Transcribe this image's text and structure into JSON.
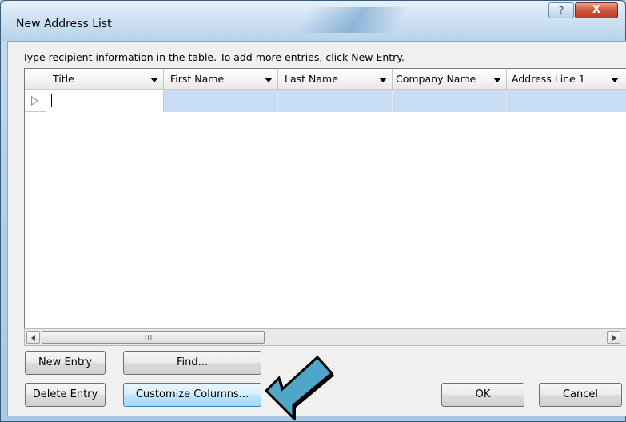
{
  "window": {
    "title": "New Address List",
    "help_glyph": "?",
    "close_glyph": "X"
  },
  "instructions": "Type recipient information in the table.  To add more entries, click New Entry.",
  "table": {
    "columns": [
      {
        "label": "Title"
      },
      {
        "label": "First Name"
      },
      {
        "label": "Last Name"
      },
      {
        "label": "Company Name"
      },
      {
        "label": "Address Line 1"
      }
    ],
    "rows": [
      {
        "cells": [
          "",
          "",
          "",
          "",
          ""
        ]
      }
    ]
  },
  "scrollbar": {
    "grip": "III"
  },
  "buttons": {
    "new_entry": "New Entry",
    "find": "Find...",
    "delete_entry": "Delete Entry",
    "customize_columns": "Customize Columns...",
    "ok": "OK",
    "cancel": "Cancel"
  },
  "annotation": {
    "arrow_color": "#4fa6c8",
    "points_to": "customize-columns-button"
  }
}
